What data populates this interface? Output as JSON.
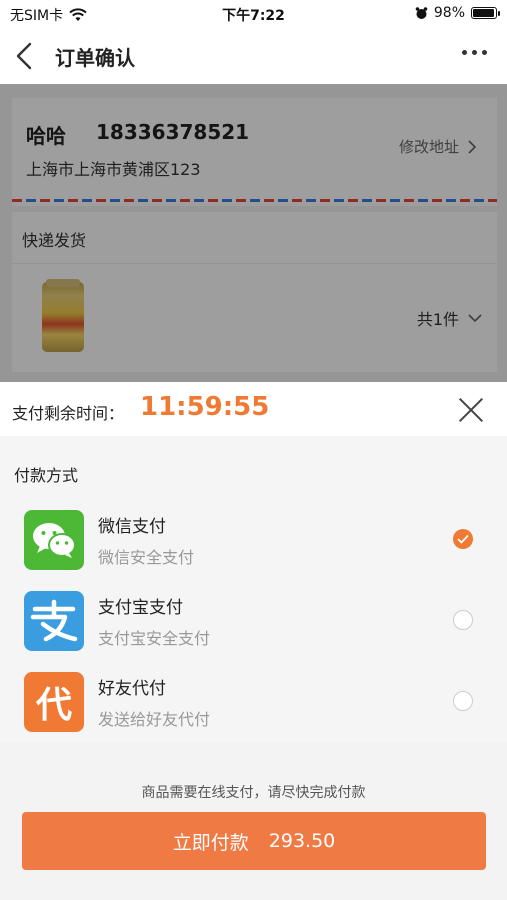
{
  "status_bar": {
    "carrier": "无SIM卡",
    "time": "下午7:22",
    "battery": "98%",
    "battery_level": 0.98
  },
  "nav": {
    "title": "订单确认"
  },
  "address": {
    "name": "哈哈",
    "phone": "18336378521",
    "detail": "上海市上海市黄浦区123",
    "edit_label": "修改地址"
  },
  "delivery": {
    "label": "快递发货"
  },
  "product": {
    "count_label": "共1件"
  },
  "payment_sheet": {
    "timer_label": "支付剩余时间：",
    "timer_value": "11:59:55",
    "methods_title": "付款方式",
    "methods": [
      {
        "name": "微信支付",
        "sub": "微信安全支付",
        "icon": "wechat-pay-icon",
        "color": "#4cb836",
        "selected": true
      },
      {
        "name": "支付宝支付",
        "sub": "支付宝安全支付",
        "icon": "alipay-icon",
        "color": "#3a9de0",
        "selected": false
      },
      {
        "name": "好友代付",
        "sub": "发送给好友代付",
        "icon": "friend-pay-icon",
        "glyph": "代",
        "color": "#f07a34",
        "selected": false
      }
    ],
    "notice": "商品需要在线支付，请尽快完成付款",
    "pay_button": {
      "label": "立即付款",
      "amount": "293.50"
    }
  },
  "colors": {
    "accent": "#f07a34",
    "pay_button": "#f07a44"
  }
}
